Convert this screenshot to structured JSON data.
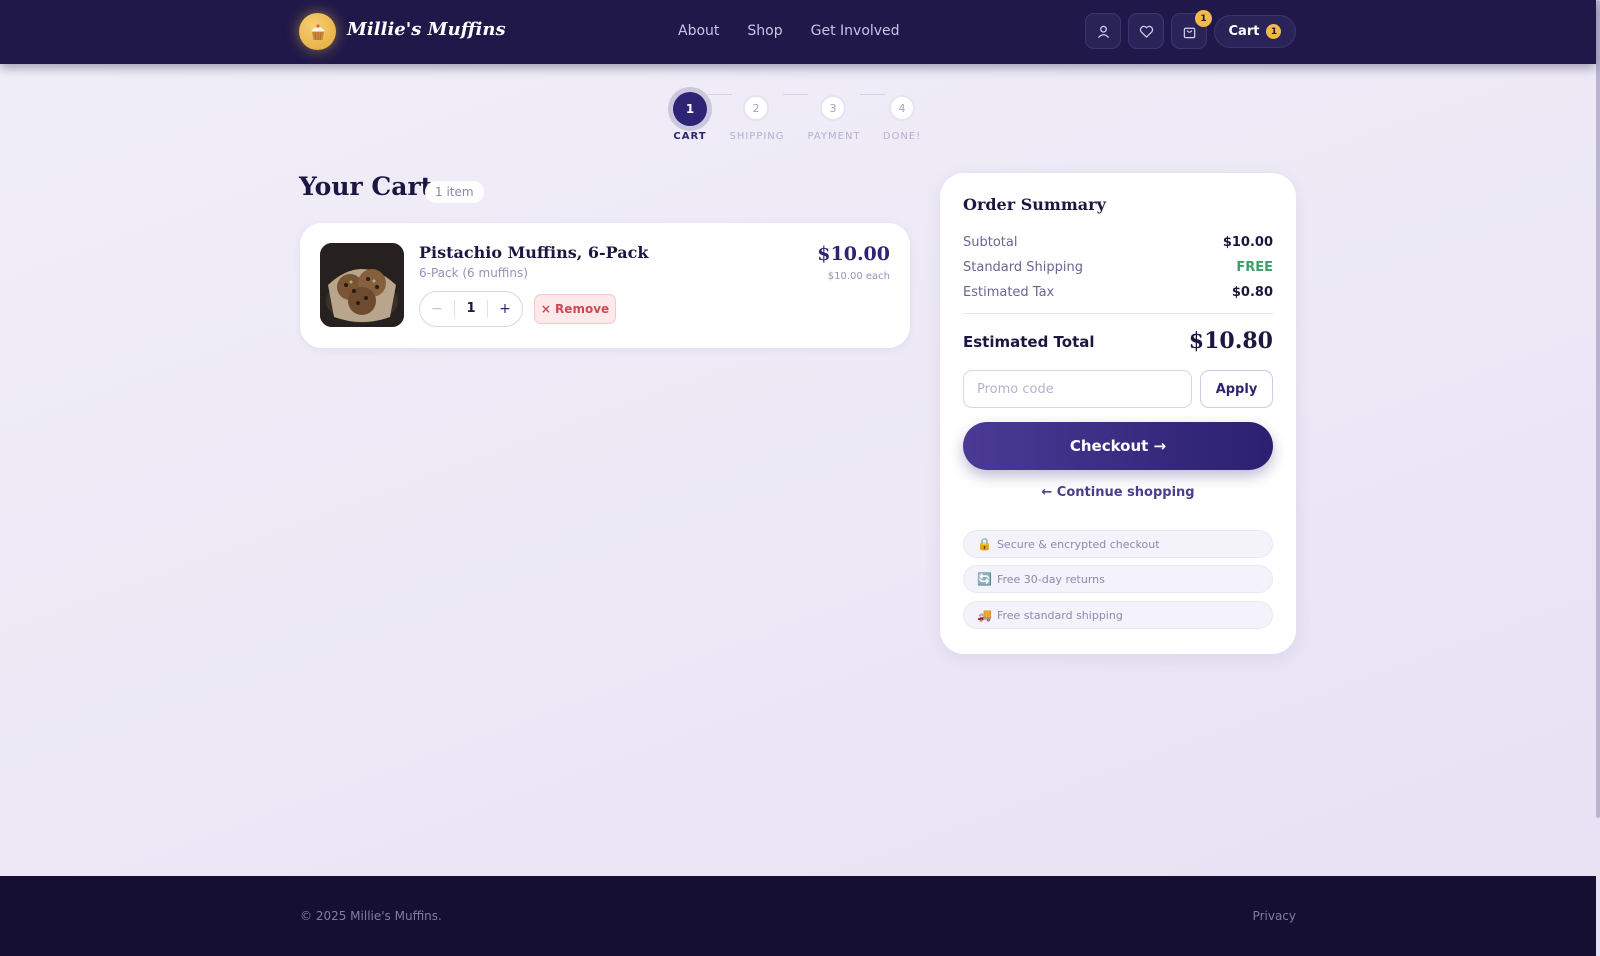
{
  "header": {
    "brand": "Millie's Muffins",
    "nav": [
      "About",
      "Shop",
      "Get Involved"
    ],
    "bag_badge": "1",
    "cart_label": "Cart",
    "cart_count": "1"
  },
  "stepper": {
    "steps": [
      {
        "num": "1",
        "label": "CART",
        "active": true
      },
      {
        "num": "2",
        "label": "SHIPPING",
        "active": false
      },
      {
        "num": "3",
        "label": "PAYMENT",
        "active": false
      },
      {
        "num": "4",
        "label": "DONE!",
        "active": false
      }
    ]
  },
  "cart": {
    "title": "Your Cart",
    "count_label": "1 item",
    "items": [
      {
        "name": "Pistachio Muffins, 6-Pack",
        "variant": "6-Pack (6 muffins)",
        "qty": "1",
        "minus": "−",
        "plus": "+",
        "remove": "× Remove",
        "price": "$10.00",
        "each": "$10.00 each"
      }
    ]
  },
  "summary": {
    "title": "Order Summary",
    "rows": [
      {
        "label": "Subtotal",
        "value": "$10.00"
      },
      {
        "label": "Standard Shipping",
        "value": "FREE"
      },
      {
        "label": "Estimated Tax",
        "value": "$0.80"
      }
    ],
    "total_label": "Estimated Total",
    "total_value": "$10.80",
    "promo_placeholder": "Promo code",
    "apply": "Apply",
    "checkout": "Checkout →",
    "continue": "← Continue shopping",
    "trust": [
      {
        "icon": "🔒",
        "text": "Secure & encrypted checkout"
      },
      {
        "icon": "🔄",
        "text": "Free 30-day returns"
      },
      {
        "icon": "🚚",
        "text": "Free standard shipping"
      }
    ]
  },
  "footer": {
    "copyright": "© 2025 Millie's Muffins.",
    "privacy": "Privacy"
  },
  "colors": {
    "header_bg": "#1f1849",
    "accent": "#2d2474",
    "badge": "#f0b94a",
    "free": "#3aa266",
    "remove": "#c94a55"
  }
}
